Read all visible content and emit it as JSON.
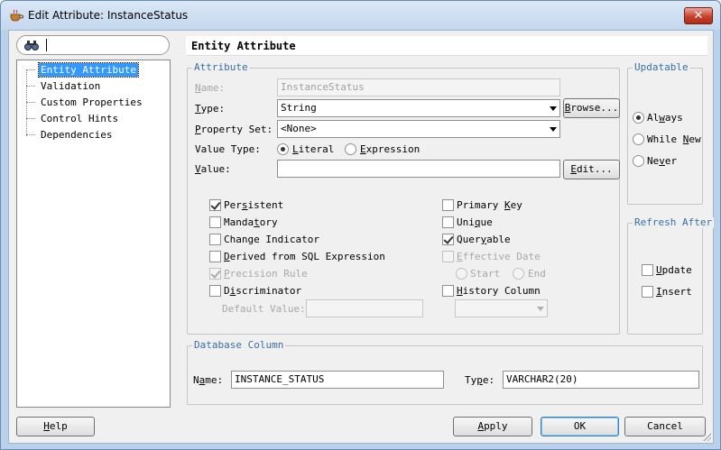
{
  "window": {
    "title": "Edit Attribute: InstanceStatus",
    "close_glyph": "✕"
  },
  "tree": {
    "items": [
      {
        "label": "Entity Attribute",
        "selected": true
      },
      {
        "label": "Validation"
      },
      {
        "label": "Custom Properties"
      },
      {
        "label": "Control Hints"
      },
      {
        "label": "Dependencies"
      }
    ]
  },
  "header": {
    "title": "Entity Attribute"
  },
  "attribute": {
    "group_title": "Attribute",
    "name_label_pre": "",
    "name_label_u": "N",
    "name_label_post": "ame:",
    "name_value": "InstanceStatus",
    "type_label_pre": "",
    "type_label_u": "T",
    "type_label_post": "ype:",
    "type_value": "String",
    "browse_pre": "",
    "browse_u": "B",
    "browse_post": "rowse...",
    "propset_label_pre": "",
    "propset_label_u": "P",
    "propset_label_post": "roperty Set:",
    "propset_value": "<None>",
    "valuetype_label": "Value Type:",
    "literal_pre": "",
    "literal_u": "L",
    "literal_post": "iteral",
    "expression_pre": "",
    "expression_u": "E",
    "expression_post": "xpression",
    "value_label_pre": "",
    "value_label_u": "V",
    "value_label_post": "alue:",
    "value_value": "",
    "edit_pre": "",
    "edit_u": "E",
    "edit_post": "dit...",
    "persistent_pre": "Per",
    "persistent_u": "s",
    "persistent_post": "istent",
    "mandatory_pre": "Manda",
    "mandatory_u": "t",
    "mandatory_post": "ory",
    "change_indicator": "Change Indicator",
    "derived_pre": "",
    "derived_u": "D",
    "derived_post": "erived from SQL Expression",
    "precision_pre": "",
    "precision_u": "P",
    "precision_post": "recision Rule",
    "discriminator_pre": "D",
    "discriminator_u": "i",
    "discriminator_post": "scriminator",
    "default_value_label": "Default Value:",
    "primary_key_pre": "Primary ",
    "primary_key_u": "K",
    "primary_key_post": "ey",
    "unique_pre": "Uni",
    "unique_u": "q",
    "unique_post": "ue",
    "queryable_pre": "Quer",
    "queryable_u": "y",
    "queryable_post": "able",
    "effective_date_pre": "",
    "effective_date_u": "E",
    "effective_date_post": "ffective Date",
    "start_label": "Start",
    "end_label": "End",
    "history_pre": "",
    "history_u": "H",
    "history_post": "istory Column"
  },
  "updatable": {
    "group_title": "Updatable",
    "always_pre": "Al",
    "always_u": "w",
    "always_post": "ays",
    "while_new_pre": "While ",
    "while_new_u": "N",
    "while_new_post": "ew",
    "never_pre": "Ne",
    "never_u": "v",
    "never_post": "er"
  },
  "refresh_after": {
    "group_title": "Refresh After",
    "update_pre": "",
    "update_u": "U",
    "update_post": "pdate",
    "insert_pre": "",
    "insert_u": "I",
    "insert_post": "nsert"
  },
  "database_column": {
    "group_title": "Database Column",
    "name_label_pre": "N",
    "name_label_u": "a",
    "name_label_post": "me:",
    "name_value": "INSTANCE_STATUS",
    "type_label_pre": "Ty",
    "type_label_u": "p",
    "type_label_post": "e:",
    "type_value": "VARCHAR2(20)"
  },
  "footer": {
    "help_pre": "",
    "help_u": "H",
    "help_post": "elp",
    "apply_pre": "",
    "apply_u": "A",
    "apply_post": "pply",
    "ok": "OK",
    "cancel": "Cancel"
  }
}
